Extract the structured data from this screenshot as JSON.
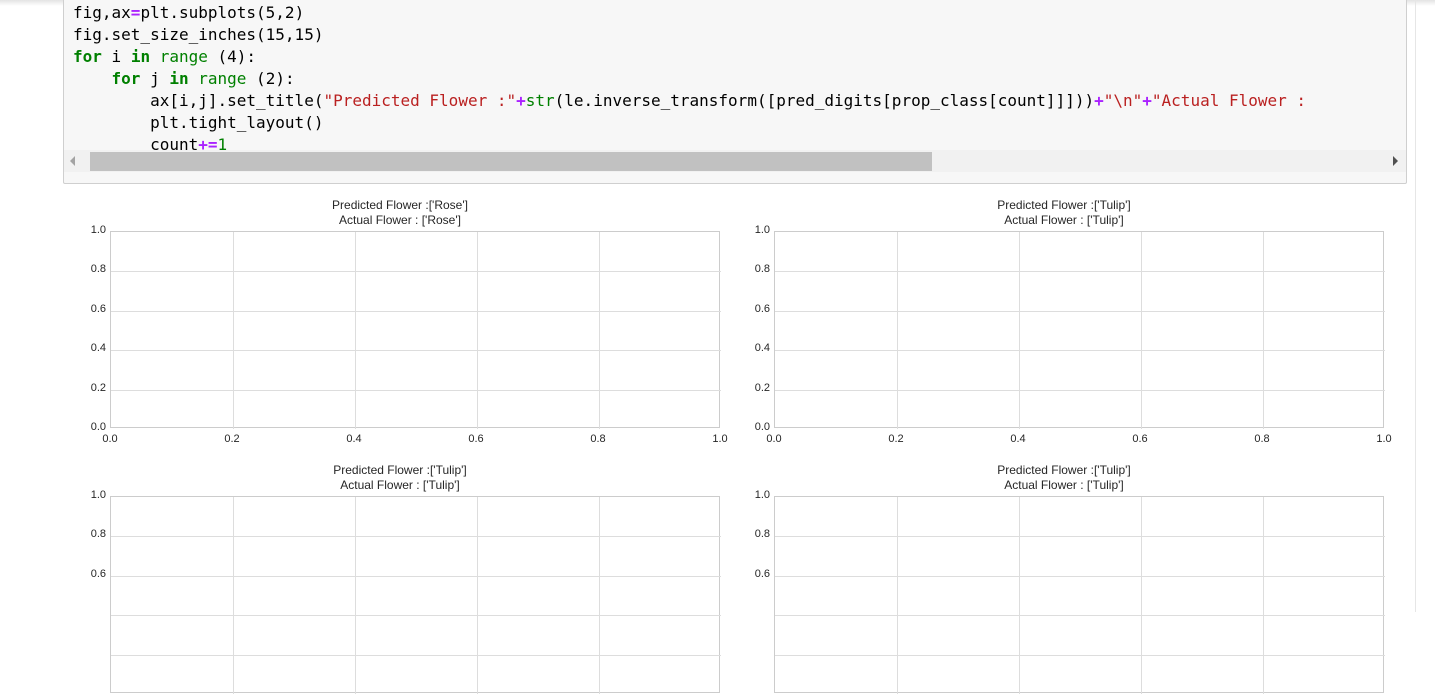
{
  "code_cell": {
    "lines": [
      [
        {
          "t": "fig,ax",
          "c": ""
        },
        {
          "t": "=",
          "c": "op"
        },
        {
          "t": "plt.subplots(5,2)",
          "c": ""
        }
      ],
      [
        {
          "t": "fig.set_size_inches(15,15)",
          "c": ""
        }
      ],
      [
        {
          "t": "for",
          "c": "kw"
        },
        {
          "t": " i ",
          "c": ""
        },
        {
          "t": "in",
          "c": "kw"
        },
        {
          "t": " ",
          "c": ""
        },
        {
          "t": "range",
          "c": "bi"
        },
        {
          "t": " (4):",
          "c": ""
        }
      ],
      [
        {
          "t": "    ",
          "c": ""
        },
        {
          "t": "for",
          "c": "kw"
        },
        {
          "t": " j ",
          "c": ""
        },
        {
          "t": "in",
          "c": "kw"
        },
        {
          "t": " ",
          "c": ""
        },
        {
          "t": "range",
          "c": "bi"
        },
        {
          "t": " (2):",
          "c": ""
        }
      ],
      [
        {
          "t": "        ax[i,j].set_title(",
          "c": ""
        },
        {
          "t": "\"Predicted Flower :\"",
          "c": "st"
        },
        {
          "t": "+",
          "c": "op"
        },
        {
          "t": "str",
          "c": "bi"
        },
        {
          "t": "(le.inverse_transform([pred_digits[prop_class[count]]]))",
          "c": ""
        },
        {
          "t": "+",
          "c": "op"
        },
        {
          "t": "\"\\n\"",
          "c": "st"
        },
        {
          "t": "+",
          "c": "op"
        },
        {
          "t": "\"Actual Flower : ",
          "c": "st"
        }
      ],
      [
        {
          "t": "        plt.tight_layout()",
          "c": ""
        }
      ],
      [
        {
          "t": "        count",
          "c": ""
        },
        {
          "t": "+=",
          "c": "op"
        },
        {
          "t": "1",
          "c": "num"
        }
      ]
    ]
  },
  "colors": {
    "accent": "#c1c1c1",
    "background": "#ffffff"
  },
  "chart_data": [
    {
      "type": "scatter",
      "predicted": "Predicted Flower :['Rose']",
      "actual": "Actual Flower : ['Rose']",
      "xlim": [
        0,
        1
      ],
      "ylim": [
        0,
        1
      ],
      "grid": true,
      "series": [],
      "xticks": [
        "0.0",
        "0.2",
        "0.4",
        "0.6",
        "0.8",
        "1.0"
      ],
      "yticks": [
        "1.0",
        "0.8",
        "0.6",
        "0.4",
        "0.2",
        "0.0"
      ]
    },
    {
      "type": "scatter",
      "predicted": "Predicted Flower :['Tulip']",
      "actual": "Actual Flower : ['Tulip']",
      "xlim": [
        0,
        1
      ],
      "ylim": [
        0,
        1
      ],
      "grid": true,
      "series": [],
      "xticks": [
        "0.0",
        "0.2",
        "0.4",
        "0.6",
        "0.8",
        "1.0"
      ],
      "yticks": [
        "1.0",
        "0.8",
        "0.6",
        "0.4",
        "0.2",
        "0.0"
      ]
    },
    {
      "type": "scatter",
      "predicted": "Predicted Flower :['Tulip']",
      "actual": "Actual Flower : ['Tulip']",
      "xlim": [
        0,
        1
      ],
      "ylim": [
        0,
        1
      ],
      "grid": true,
      "series": [],
      "xticks": [],
      "yticks": [
        "1.0",
        "0.8",
        "0.6"
      ]
    },
    {
      "type": "scatter",
      "predicted": "Predicted Flower :['Tulip']",
      "actual": "Actual Flower : ['Tulip']",
      "xlim": [
        0,
        1
      ],
      "ylim": [
        0,
        1
      ],
      "grid": true,
      "series": [],
      "xticks": [],
      "yticks": [
        "1.0",
        "0.8",
        "0.6"
      ]
    }
  ]
}
